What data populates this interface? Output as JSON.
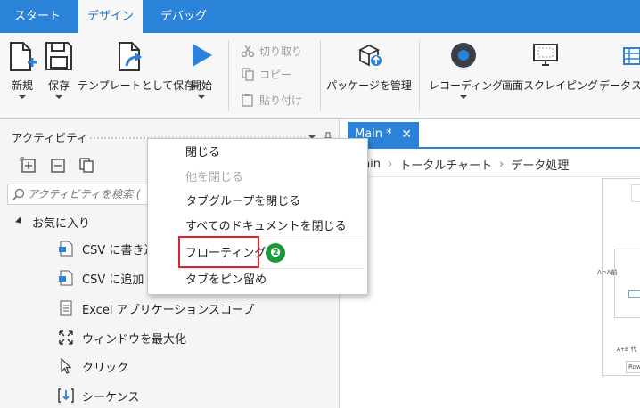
{
  "ribbon_tabs": [
    "スタート",
    "デザイン",
    "デバッグ"
  ],
  "active_tab": "デザイン",
  "ribbon": {
    "new": "新規",
    "save": "保存",
    "save_template": "テンプレートとして保存",
    "start": "開始",
    "cut": "切り取り",
    "copy": "コピー",
    "paste": "貼り付け",
    "manage_packages": "パッケージを管理",
    "recording": "レコーディング",
    "screen_scraping": "画面スクレイピング",
    "data_scraping": "データスク"
  },
  "panel": {
    "title": "アクティビティ",
    "search_placeholder": "アクティビティを検索 (",
    "favorites": "お気に入り",
    "items": [
      "CSV に書き込",
      "CSV に追加",
      "Excel アプリケーションスコープ",
      "ウィンドウを最大化",
      "クリック",
      "シーケンス"
    ]
  },
  "document": {
    "tab_label": "Main *",
    "breadcrumb": [
      "Main",
      "トータルチャート",
      "データ処理"
    ],
    "assign_label": "A=A前",
    "abc_label": "代",
    "row_label": "Row"
  },
  "context_menu": {
    "items": [
      "閉じる",
      "他を閉じる",
      "タブグループを閉じる",
      "すべてのドキュメントを閉じる",
      "フローティング",
      "タブをピン留め"
    ]
  },
  "callout_number": "❷",
  "colors": {
    "accent": "#2b82d9",
    "highlight": "#e0202a",
    "badge": "#1a9b3a"
  }
}
